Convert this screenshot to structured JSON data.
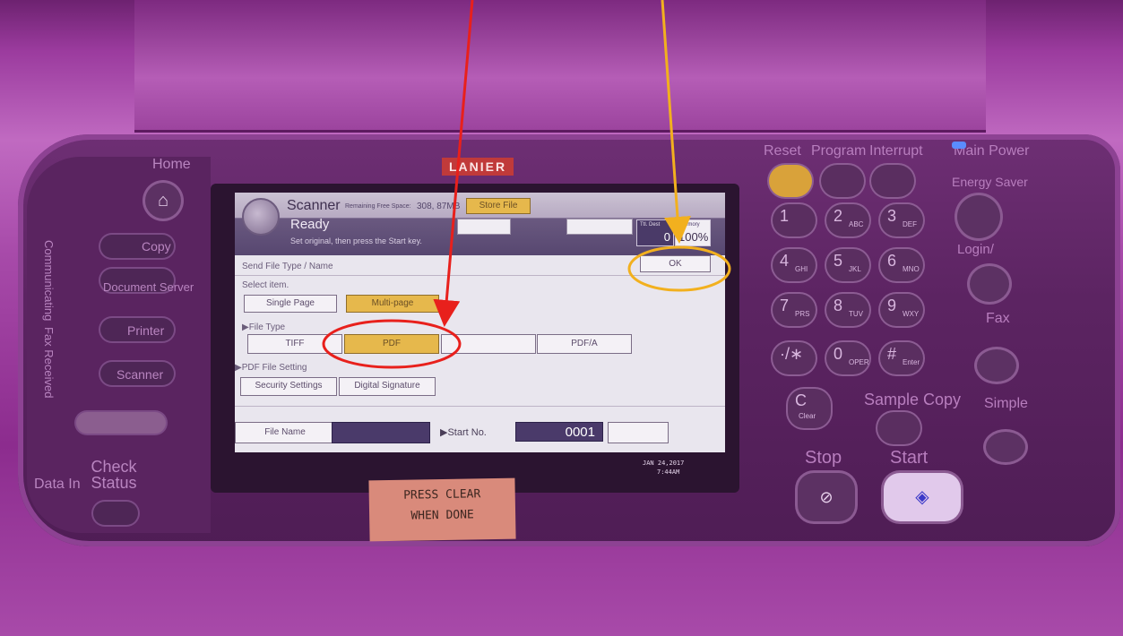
{
  "device": {
    "brand": "LANIER",
    "left_panel": {
      "home": "Home",
      "copy": "Copy",
      "document_server": "Document Server",
      "printer": "Printer",
      "scanner": "Scanner",
      "communicating": "Communicating",
      "fax_received": "Fax Received",
      "check_status": "Check Status",
      "data_in": "Data In"
    },
    "top_right_labels": {
      "reset": "Reset",
      "program": "Program",
      "interrupt": "Interrupt",
      "main_power": "Main Power",
      "energy_saver": "Energy Saver"
    },
    "keypad": [
      {
        "n": "1",
        "l": ""
      },
      {
        "n": "2",
        "l": "ABC"
      },
      {
        "n": "3",
        "l": "DEF"
      },
      {
        "n": "4",
        "l": "GHI"
      },
      {
        "n": "5",
        "l": "JKL"
      },
      {
        "n": "6",
        "l": "MNO"
      },
      {
        "n": "7",
        "l": "PRS"
      },
      {
        "n": "8",
        "l": "TUV"
      },
      {
        "n": "9",
        "l": "WXY"
      },
      {
        "n": "·/∗",
        "l": ""
      },
      {
        "n": "0",
        "l": "OPER"
      },
      {
        "n": "#",
        "l": "Enter"
      }
    ],
    "clear_label": "C",
    "clear_sub": "Clear",
    "sample_copy": "Sample Copy",
    "stop": "Stop",
    "start": "Start",
    "right_side": {
      "login": "Login/",
      "fax": "Fax",
      "simple": "Simple"
    }
  },
  "screen": {
    "app_title": "Scanner",
    "free_space_label": "Remaining Free Space:",
    "free_space_value": "308, 87MB",
    "store_file": "Store File",
    "status": "Ready",
    "instruction": "Set original, then press the Start key.",
    "total_dest_label": "Ttl. Dest",
    "total_dest_value": "0",
    "memory_label": "Memory",
    "memory_value": "100%",
    "section_title": "Send File Type / Name",
    "ok": "OK",
    "select_item": "Select item.",
    "single_page": "Single Page",
    "multi_page": "Multi-page",
    "file_type_label": "▶File Type",
    "file_types": [
      "TIFF",
      "PDF",
      "",
      "PDF/A"
    ],
    "pdf_setting_label": "▶PDF File Setting",
    "security_settings": "Security Settings",
    "digital_signature": "Digital Signature",
    "file_name": "File Name",
    "start_no_label": "▶Start No.",
    "start_no_value": "0001",
    "date": "JAN  24,2017",
    "time": "7:44AM"
  },
  "note": {
    "line1": "PRESS CLEAR",
    "line2": "WHEN DONE"
  },
  "annotation_colors": {
    "red": "#e8201c",
    "orange": "#f2b01e"
  }
}
